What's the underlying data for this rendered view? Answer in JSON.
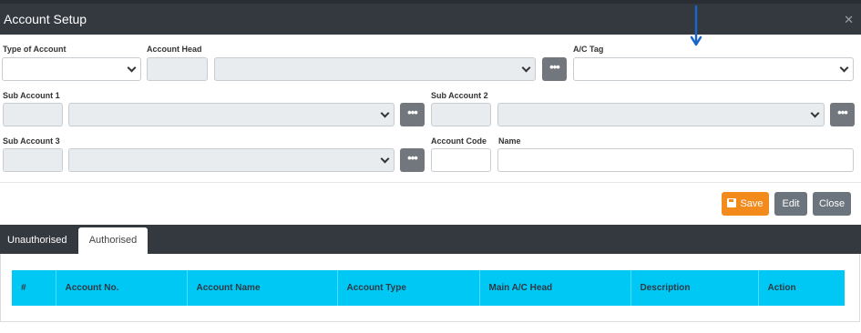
{
  "window": {
    "title": "Account Setup",
    "close_icon": "close-icon"
  },
  "form": {
    "type_of_account": {
      "label": "Type of Account",
      "value": ""
    },
    "account_head": {
      "label": "Account Head",
      "code_value": "",
      "value": ""
    },
    "ac_tag": {
      "label": "A/C Tag",
      "value": ""
    },
    "sub_account_1": {
      "label": "Sub Account 1",
      "code_value": "",
      "value": ""
    },
    "sub_account_2": {
      "label": "Sub Account 2",
      "code_value": "",
      "value": ""
    },
    "sub_account_3": {
      "label": "Sub Account 3",
      "code_value": "",
      "value": ""
    },
    "account_code": {
      "label": "Account Code",
      "value": ""
    },
    "name": {
      "label": "Name",
      "value": ""
    },
    "more_button_label": "•••"
  },
  "actions": {
    "save": "Save",
    "edit": "Edit",
    "close": "Close"
  },
  "tabs": [
    {
      "label": "Unauthorised",
      "active": false
    },
    {
      "label": "Authorised",
      "active": true
    }
  ],
  "table": {
    "columns": [
      "#",
      "Account No.",
      "Account Name",
      "Account Type",
      "Main A/C Head",
      "Description",
      "Action"
    ],
    "rows": []
  },
  "colors": {
    "header_bg": "#34383f",
    "save_button": "#f28a1c",
    "secondary_button": "#6c757d",
    "table_header": "#00c8f5",
    "annotation_arrow": "#1a66c8"
  }
}
